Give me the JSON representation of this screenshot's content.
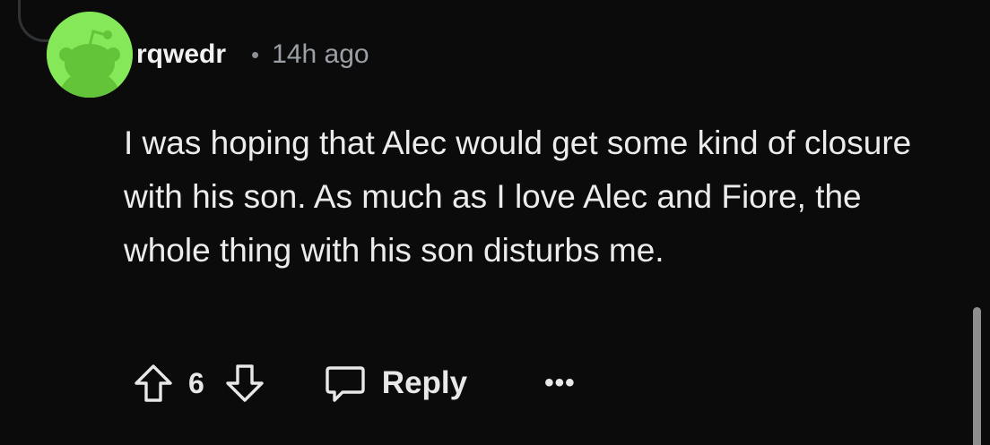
{
  "comment": {
    "username": "rqwedr",
    "separator": "•",
    "timestamp": "14h ago",
    "body": "I was hoping that Alec would get some kind of closure with his son. As much as I love Alec and Fiore, the whole thing with his son disturbs me.",
    "avatar_icon": "snoo-avatar-icon",
    "avatar_color": "#84e858"
  },
  "actions": {
    "upvote_icon": "upvote-arrow-icon",
    "score": "6",
    "downvote_icon": "downvote-arrow-icon",
    "reply_icon": "speech-bubble-icon",
    "reply_label": "Reply",
    "more_label": "•••"
  },
  "colors": {
    "background": "#0b0b0c",
    "text": "#ececec",
    "muted": "#9aa0a5"
  }
}
